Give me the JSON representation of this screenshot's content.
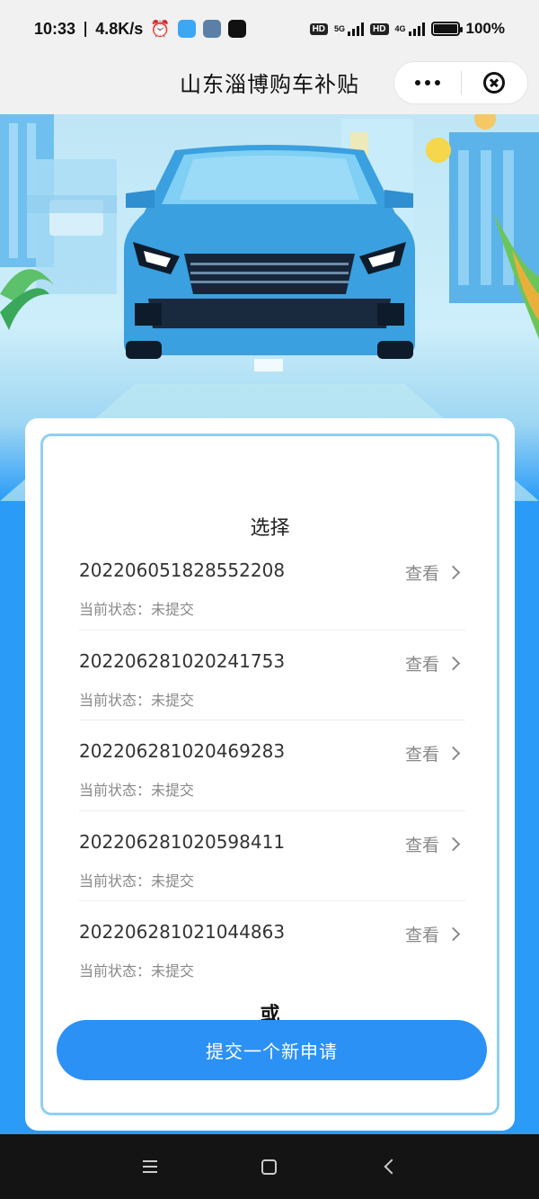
{
  "status_bar": {
    "time": "10:33",
    "speed": "4.8K/s",
    "battery": "100%",
    "net1": "5G",
    "net2": "4G",
    "hd": "HD"
  },
  "nav": {
    "title": "山东淄博购车补贴"
  },
  "main": {
    "select_title": "选择",
    "view_label": "查看",
    "status_prefix": "当前状态：",
    "applications": [
      {
        "number": "202206051828552208",
        "status": "未提交"
      },
      {
        "number": "202206281020241753",
        "status": "未提交"
      },
      {
        "number": "202206281020469283",
        "status": "未提交"
      },
      {
        "number": "202206281020598411",
        "status": "未提交"
      },
      {
        "number": "202206281021044863",
        "status": "未提交"
      }
    ],
    "or_text": "或",
    "submit_label": "提交一个新申请"
  },
  "colors": {
    "primary": "#2b91f5",
    "page_bg": "#2a9cf8",
    "card_border": "#8fd0f2"
  },
  "icons": [
    "alarm-icon",
    "more-dots-icon",
    "close-circle-icon",
    "chevron-right-icon",
    "menu-icon",
    "home-icon",
    "back-icon"
  ]
}
